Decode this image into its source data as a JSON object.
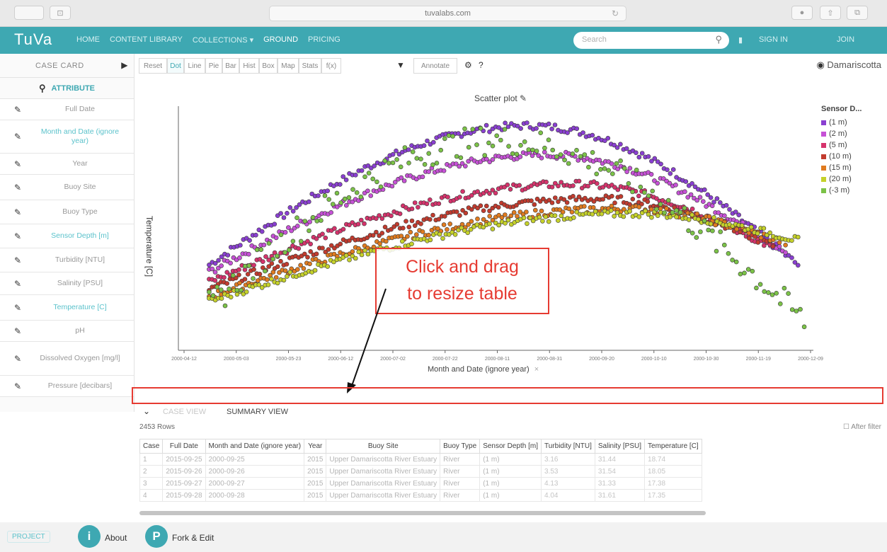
{
  "browser": {
    "url": "tuvalabs.com",
    "back_label": "",
    "tabs_label": "⊡"
  },
  "nav": {
    "logo": "TuVa",
    "items": [
      "HOME",
      "CONTENT LIBRARY",
      "COLLECTIONS ▾",
      "GROUND",
      "PRICING"
    ],
    "search_placeholder": "Search",
    "right_items": [
      "SIGN IN",
      "JOIN"
    ]
  },
  "left_panel": {
    "case_card": "CASE CARD",
    "attribute_label": "ATTRIBUTE",
    "attributes": [
      {
        "label": "Full Date",
        "active": false
      },
      {
        "label": "Month and Date (ignore year)",
        "active": true
      },
      {
        "label": "Year",
        "active": false
      },
      {
        "label": "Buoy Site",
        "active": false
      },
      {
        "label": "Buoy Type",
        "active": false
      },
      {
        "label": "Sensor Depth [m]",
        "active": true
      },
      {
        "label": "Turbidity [NTU]",
        "active": false
      },
      {
        "label": "Salinity [PSU]",
        "active": false
      },
      {
        "label": "Temperature [C]",
        "active": true
      },
      {
        "label": "pH",
        "active": false
      },
      {
        "label": "Dissolved Oxygen [mg/l]",
        "active": false
      },
      {
        "label": "Pressure [decibars]",
        "active": false
      }
    ]
  },
  "toolbar": {
    "tools": [
      "Reset",
      "Dot",
      "Line",
      "Pie",
      "Bar",
      "Hist",
      "Box",
      "Map",
      "Stats",
      "f(x)",
      "Annotate"
    ],
    "active_tool": "Dot",
    "location": "Damariscotta"
  },
  "chart_data": {
    "type": "scatter",
    "title": "Scatter plot",
    "xlabel": "Month and Date (ignore year)",
    "ylabel": "Temperature [C]",
    "x_ticks": [
      "2000-04-12",
      "2000-05-03",
      "2000-05-23",
      "2000-06-12",
      "2000-07-02",
      "2000-07-22",
      "2000-08-11",
      "2000-08-31",
      "2000-09-20",
      "2000-10-10",
      "2000-10-30",
      "2000-11-19",
      "2000-12-09"
    ],
    "legend_title": "Sensor D...",
    "series": [
      {
        "name": "(1 m)",
        "color": "#8a3fd1"
      },
      {
        "name": "(2 m)",
        "color": "#c651d6"
      },
      {
        "name": "(5 m)",
        "color": "#d6336c"
      },
      {
        "name": "(10 m)",
        "color": "#c23b2e"
      },
      {
        "name": "(15 m)",
        "color": "#e07b1f"
      },
      {
        "name": "(20 m)",
        "color": "#c5d12a"
      },
      {
        "name": "(-3 m)",
        "color": "#7bc247"
      }
    ],
    "grid": false,
    "legend_position": "top-right"
  },
  "annotation": {
    "line1": "Click and drag",
    "line2": "to resize table"
  },
  "bottom": {
    "tab_case": "CASE VIEW",
    "tab_summary": "SUMMARY VIEW",
    "rows_label": "2453 Rows",
    "after_filter": "After filter"
  },
  "table": {
    "columns": [
      "Case",
      "Full Date",
      "Month and Date (ignore year)",
      "Year",
      "Buoy Site",
      "Buoy Type",
      "Sensor Depth [m]",
      "Turbidity [NTU]",
      "Salinity [PSU]",
      "Temperature [C]"
    ],
    "rows": [
      [
        "1",
        "2015-09-25",
        "2000-09-25",
        "2015",
        "Upper Damariscotta River Estuary",
        "River",
        "(1 m)",
        "3.16",
        "31.44",
        "18.74"
      ],
      [
        "2",
        "2015-09-26",
        "2000-09-26",
        "2015",
        "Upper Damariscotta River Estuary",
        "River",
        "(1 m)",
        "3.53",
        "31.54",
        "18.05"
      ],
      [
        "3",
        "2015-09-27",
        "2000-09-27",
        "2015",
        "Upper Damariscotta River Estuary",
        "River",
        "(1 m)",
        "4.13",
        "31.33",
        "17.38"
      ],
      [
        "4",
        "2015-09-28",
        "2000-09-28",
        "2015",
        "Upper Damariscotta River Estuary",
        "River",
        "(1 m)",
        "4.04",
        "31.61",
        "17.35"
      ]
    ]
  },
  "footer": {
    "project_label": "PROJECT",
    "about": "About",
    "about_icon": "i",
    "fork": "Fork & Edit",
    "fork_icon": "P"
  }
}
